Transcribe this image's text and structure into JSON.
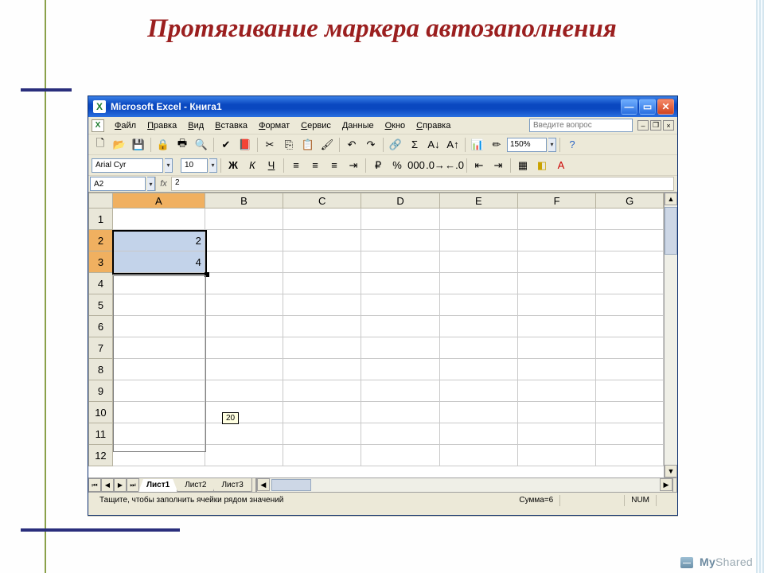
{
  "slide": {
    "title": "Протягивание маркера автозаполнения"
  },
  "window": {
    "title": "Microsoft Excel - Книга1"
  },
  "menu": {
    "items": [
      "Файл",
      "Правка",
      "Вид",
      "Вставка",
      "Формат",
      "Сервис",
      "Данные",
      "Окно",
      "Справка"
    ],
    "help_placeholder": "Введите вопрос"
  },
  "toolbar": {
    "zoom": "150%"
  },
  "format_bar": {
    "font": "Arial Cyr",
    "size": "10",
    "bold": "Ж",
    "italic": "К",
    "underline": "Ч"
  },
  "formula": {
    "name_box": "A2",
    "fx_label": "fx",
    "value": "2"
  },
  "grid": {
    "columns": [
      "A",
      "B",
      "C",
      "D",
      "E",
      "F",
      "G"
    ],
    "rows": [
      "1",
      "2",
      "3",
      "4",
      "5",
      "6",
      "7",
      "8",
      "9",
      "10",
      "11",
      "12"
    ],
    "active_col": "A",
    "cells": {
      "A2": "2",
      "A3": "4"
    },
    "drag_tooltip": "20"
  },
  "tabs": {
    "items": [
      "Лист1",
      "Лист2",
      "Лист3"
    ],
    "active": 0
  },
  "status": {
    "hint": "Тащите, чтобы заполнить ячейки рядом значений",
    "sum": "Сумма=6",
    "num": "NUM"
  },
  "footer": {
    "brand_a": "My",
    "brand_b": "Shared"
  }
}
